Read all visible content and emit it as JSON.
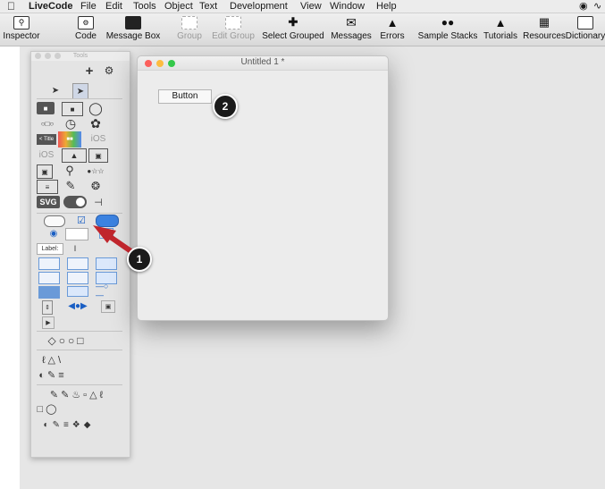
{
  "menubar": {
    "app_name": "LiveCode",
    "items": [
      "File",
      "Edit",
      "Tools",
      "Object",
      "Text",
      "Development",
      "View",
      "Window",
      "Help"
    ]
  },
  "toolbar": {
    "items": [
      {
        "label": "Inspector",
        "icon": "inspector-icon",
        "enabled": true
      },
      {
        "label": "Code",
        "icon": "code-icon",
        "enabled": true
      },
      {
        "label": "Message Box",
        "icon": "message-box-icon",
        "enabled": true
      },
      {
        "label": "Group",
        "icon": "group-icon",
        "enabled": false
      },
      {
        "label": "Edit Group",
        "icon": "edit-group-icon",
        "enabled": false
      },
      {
        "label": "Select Grouped",
        "icon": "select-grouped-icon",
        "enabled": true
      },
      {
        "label": "Messages",
        "icon": "messages-icon",
        "enabled": true
      },
      {
        "label": "Errors",
        "icon": "errors-icon",
        "enabled": true
      },
      {
        "label": "Sample Stacks",
        "icon": "sample-stacks-icon",
        "enabled": true
      },
      {
        "label": "Tutorials",
        "icon": "tutorials-icon",
        "enabled": true
      },
      {
        "label": "Resources",
        "icon": "resources-icon",
        "enabled": true
      },
      {
        "label": "Dictionary",
        "icon": "dictionary-icon",
        "enabled": true
      }
    ]
  },
  "tools_palette": {
    "title": "Tools",
    "label_widget": "Label:",
    "svg_widget": "SVG",
    "title_widget": "< Title"
  },
  "stack_window": {
    "title": "Untitled 1 *",
    "button_label": "Button"
  },
  "callouts": [
    "1",
    "2"
  ],
  "colors": {
    "close": "#fc605c",
    "minimize": "#fdbc40",
    "zoom": "#34c84a",
    "arrow": "#c0262d",
    "callout": "#1b1b1b"
  }
}
